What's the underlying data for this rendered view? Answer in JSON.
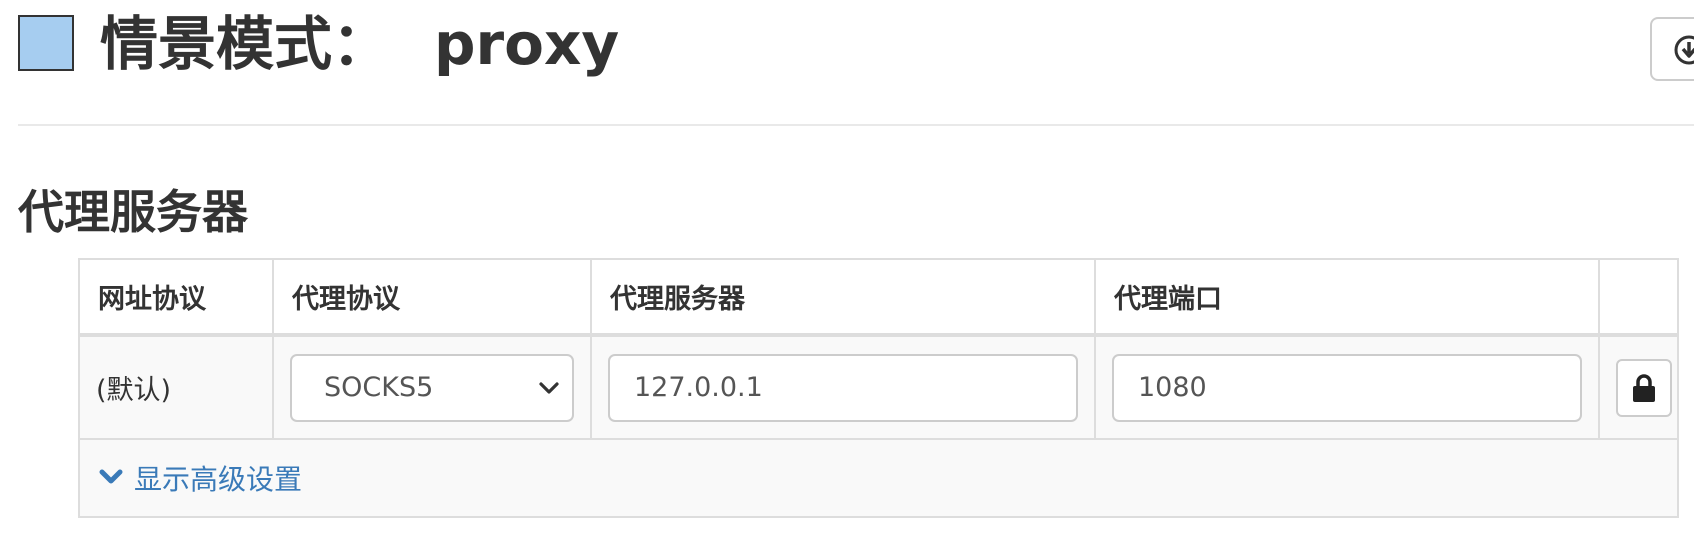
{
  "header": {
    "title_label": "情景模式：",
    "profile_name": "proxy",
    "profile_color": "#a6cdf0",
    "action_icon": "download-icon"
  },
  "section": {
    "title": "代理服务器"
  },
  "table": {
    "columns": [
      "网址协议",
      "代理协议",
      "代理服务器",
      "代理端口",
      ""
    ],
    "rows": [
      {
        "scheme": "(默认)",
        "protocol": "SOCKS5",
        "server": "127.0.0.1",
        "port": "1080",
        "action_icon": "lock-icon"
      }
    ]
  },
  "advanced": {
    "toggle_label": "显示高级设置",
    "icon": "chevron-down-icon"
  },
  "colors": {
    "link": "#3a7ab8",
    "text": "#333333",
    "border": "#dddddd"
  }
}
